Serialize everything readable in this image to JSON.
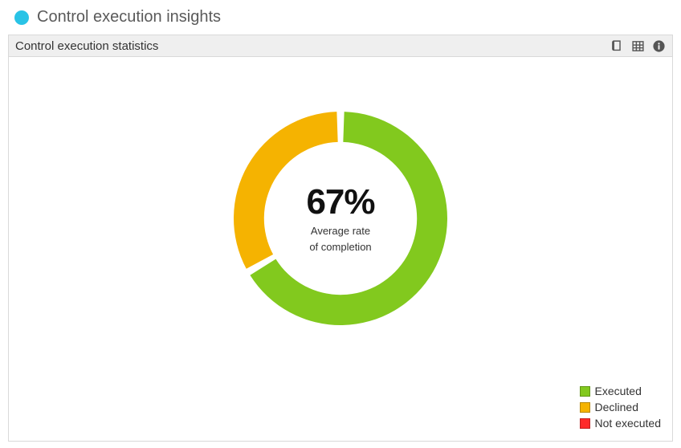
{
  "title": "Control execution insights",
  "panel": {
    "title": "Control execution statistics"
  },
  "center": {
    "value": "67%",
    "line1": "Average rate",
    "line2": "of completion"
  },
  "legend": {
    "executed": "Executed",
    "declined": "Declined",
    "not_executed": "Not executed"
  },
  "colors": {
    "executed": "#82c91e",
    "declined": "#f5b301",
    "not_executed": "#ff2a2a",
    "status_dot": "#29c3e6"
  },
  "chart_data": {
    "type": "pie",
    "title": "Control execution statistics",
    "center_value": 67,
    "center_label": "Average rate of completion",
    "series": [
      {
        "name": "Executed",
        "value": 67
      },
      {
        "name": "Declined",
        "value": 33
      },
      {
        "name": "Not executed",
        "value": 0
      }
    ]
  }
}
